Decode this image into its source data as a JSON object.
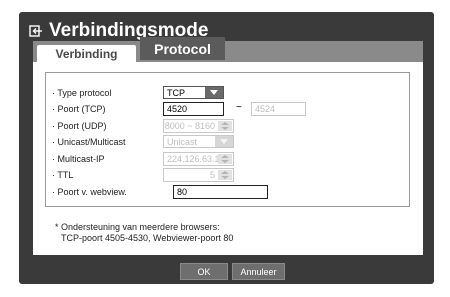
{
  "window": {
    "title": "Verbindingsmode"
  },
  "tabs": [
    {
      "label": "Verbinding",
      "active": true
    },
    {
      "label": "Protocol",
      "active": false
    }
  ],
  "form": {
    "type_protocol": {
      "label": "· Type protocol",
      "value": "TCP"
    },
    "poort_tcp": {
      "label": "· Poort (TCP)",
      "value": "4520",
      "range_end": "4524",
      "separator": "~"
    },
    "poort_udp": {
      "label": "· Poort (UDP)",
      "value": "8000 ~ 8160"
    },
    "unicast_multicast": {
      "label": "· Unicast/Multicast",
      "value": "Unicast"
    },
    "multicast_ip": {
      "label": "· Multicast-IP",
      "value": "224.126.63.1"
    },
    "ttl": {
      "label": "· TTL",
      "value": "5"
    },
    "poort_webview": {
      "label": "· Poort v. webview.",
      "value": "80"
    }
  },
  "note": {
    "line1": "* Ondersteuning van meerdere browsers:",
    "line2": "TCP-poort 4505-4530, Webviewer-poort 80"
  },
  "buttons": {
    "ok": "OK",
    "cancel": "Annuleer"
  },
  "icons": {
    "title": "network-return-icon",
    "dropdown": "chevron-down-icon",
    "spinner": "spinner-arrows-icon"
  },
  "colors": {
    "dialog_bg": "#3a3a3a",
    "tabstrip_bg": "#8a8a8a",
    "button_bg": "#6e6e6e"
  }
}
